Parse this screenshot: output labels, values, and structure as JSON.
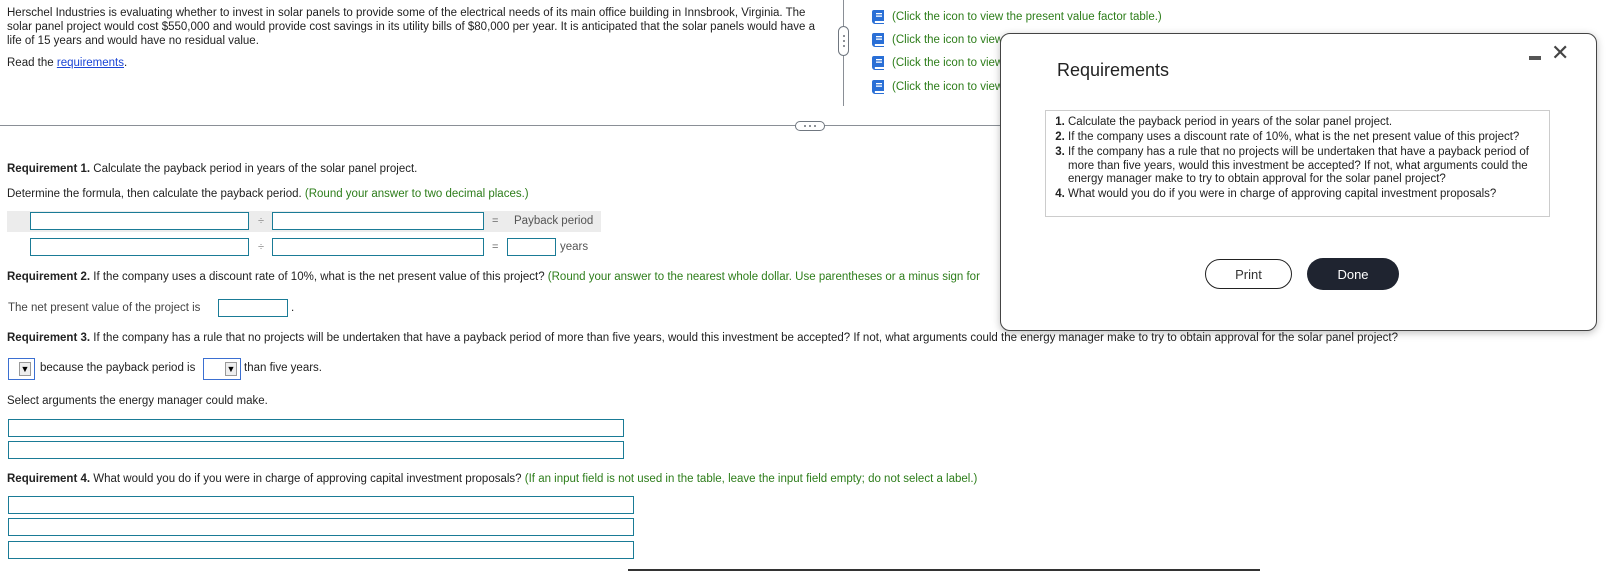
{
  "problem": {
    "paragraph": "Herschel Industries is evaluating whether to invest in solar panels to provide some of the electrical needs of its main office building in Innsbrook, Virginia. The solar panel project would cost $550,000 and would provide cost savings in its utility bills of $80,000 per year. It is anticipated that the solar panels would have a life of 15 years and would have no residual value.",
    "read_prefix": "Read the ",
    "read_link": "requirements",
    "read_suffix": "."
  },
  "resources": [
    {
      "icon": "book-icon",
      "text": "(Click the icon to view the present value factor table.)"
    },
    {
      "icon": "book-icon",
      "text": "(Click the icon to view"
    },
    {
      "icon": "book-icon",
      "text": "(Click the icon to view"
    },
    {
      "icon": "book-icon",
      "text": "(Click the icon to view"
    }
  ],
  "req1": {
    "label": "Requirement 1.",
    "text": " Calculate the payback period in years of the solar panel project.",
    "instruction": "Determine the formula, then calculate the payback period.",
    "hint": " (Round your answer to two decimal places.)",
    "divide": "÷",
    "equals": "=",
    "result_label": "Payback period",
    "unit": "years",
    "inputs": {
      "row1_a": "",
      "row1_b": "",
      "row2_a": "",
      "row2_b": "",
      "result": ""
    }
  },
  "req2": {
    "label": "Requirement 2.",
    "text": " If the company uses a discount rate of 10%, what is the net present value of this project?",
    "hint": " (Round your answer to the nearest whole dollar. Use parentheses or a minus sign for",
    "npv_label": "The net present value of the project is",
    "npv_suffix": ".",
    "npv_value": ""
  },
  "req3": {
    "label": "Requirement 3.",
    "text": " If the company has a rule that no projects will be undertaken that have a payback period of more than five years, would this investment be accepted? If not, what arguments could the energy manager make to try to obtain approval for the solar panel project?",
    "because_text": "because the payback period is",
    "than_text": "than five years.",
    "select1_value": "",
    "select2_value": "",
    "arrow": "▼",
    "arguments_label": "Select arguments the energy manager could make.",
    "arguments": [
      "",
      ""
    ]
  },
  "req4": {
    "label": "Requirement 4.",
    "text": " What would you do if you were in charge of approving capital investment proposals?",
    "hint": " (If an input field is not used in the table, leave the input field empty; do not select a label.)",
    "answers": [
      "",
      "",
      ""
    ]
  },
  "modal": {
    "title": "Requirements",
    "minimize": "minimize-icon",
    "close": "✕",
    "items": [
      "Calculate the payback period in years of the solar panel project.",
      "If the company uses a discount rate of 10%, what is the net present value of this project?",
      "If the company has a rule that no projects will be undertaken that have a payback period of more than five years, would this investment be accepted? If not, what arguments could the energy manager make to try to obtain approval for the solar panel project?",
      "What would you do if you were in charge of approving capital investment proposals?"
    ],
    "print_label": "Print",
    "done_label": "Done"
  },
  "colors": {
    "hint_green": "#2d7d1a",
    "link_blue": "#1a44d6",
    "input_border": "#1a7b96",
    "done_bg": "#1f2430",
    "book_blue": "#2a6fd6"
  }
}
